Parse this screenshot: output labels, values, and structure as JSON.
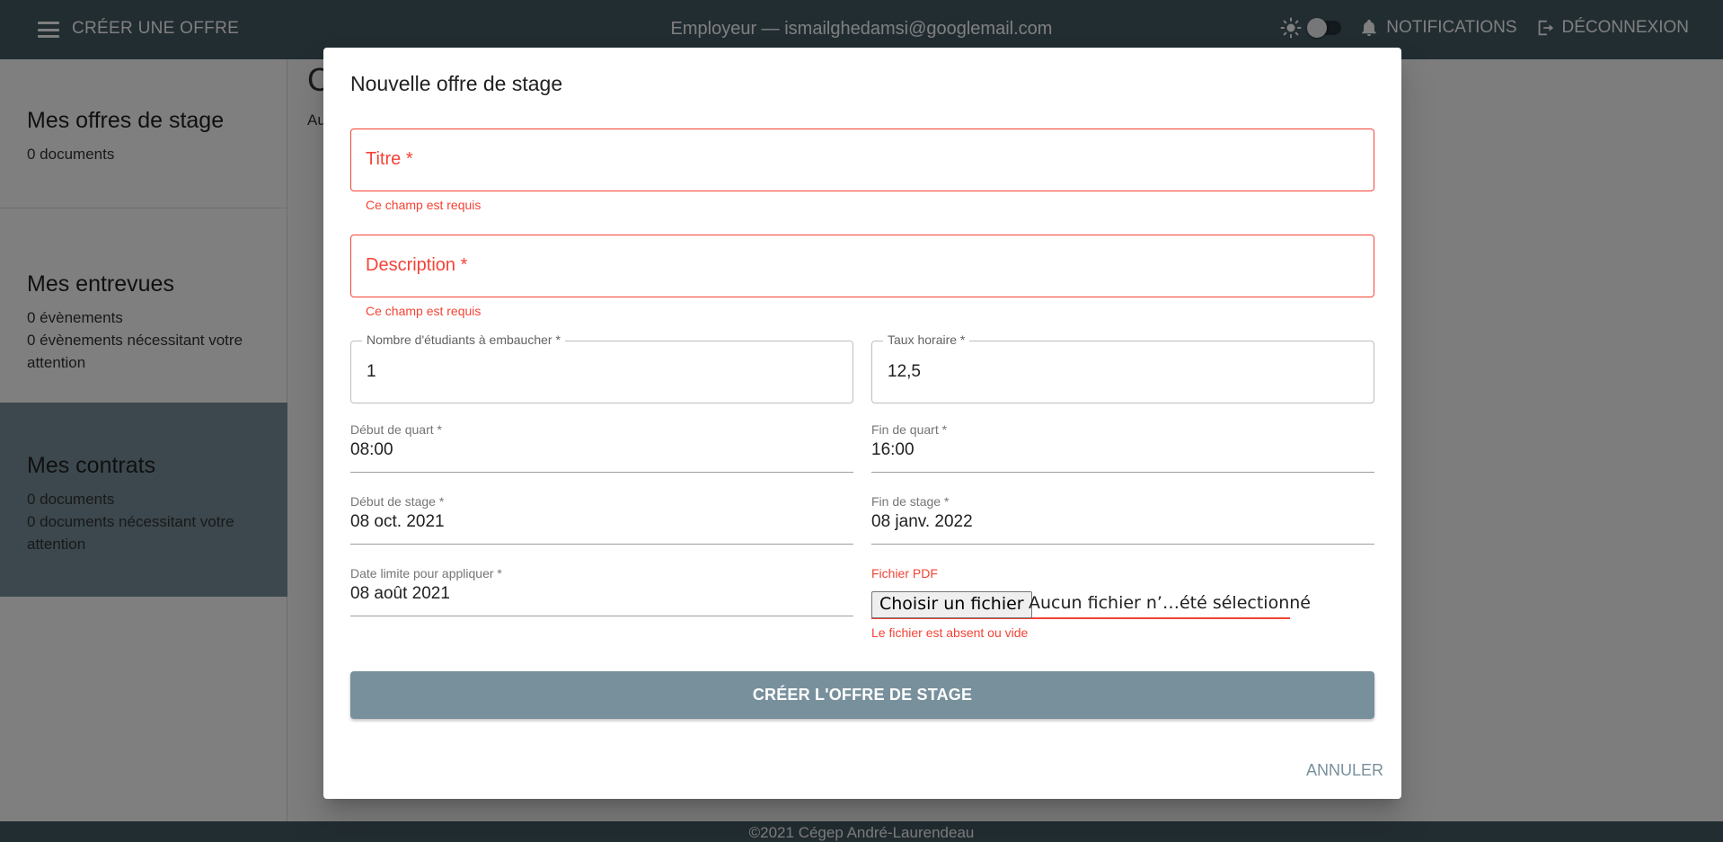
{
  "appbar": {
    "create_label": "CRÉER UNE OFFRE",
    "user_label": "Employeur — ismailghedamsi@googlemail.com",
    "notifications_label": "NOTIFICATIONS",
    "logout_label": "DÉCONNEXION"
  },
  "sidebar": {
    "cards": [
      {
        "title": "Mes offres de stage",
        "lines": [
          "0 documents"
        ]
      },
      {
        "title": "Mes entrevues",
        "lines": [
          "0 évènements",
          "0 évènements nécessitant votre attention"
        ]
      },
      {
        "title": "Mes contrats",
        "lines": [
          "0 documents",
          "0 documents nécessitant votre attention"
        ]
      }
    ]
  },
  "main": {
    "title_partial": "C",
    "sub_partial": "Au"
  },
  "footer": {
    "text": "©2021 Cégep André-Laurendeau"
  },
  "dialog": {
    "title": "Nouvelle offre de stage",
    "titre": {
      "placeholder": "Titre *",
      "error": "Ce champ est requis"
    },
    "description": {
      "placeholder": "Description *",
      "error": "Ce champ est requis"
    },
    "nb_etudiants": {
      "label": "Nombre d'étudiants à embaucher *",
      "value": "1"
    },
    "taux_horaire": {
      "label": "Taux horaire *",
      "value": "12,5"
    },
    "debut_quart": {
      "label": "Début de quart *",
      "value": "08:00"
    },
    "fin_quart": {
      "label": "Fin de quart *",
      "value": "16:00"
    },
    "debut_stage": {
      "label": "Début de stage *",
      "value": "08 oct. 2021"
    },
    "fin_stage": {
      "label": "Fin de stage *",
      "value": "08 janv. 2022"
    },
    "date_limite": {
      "label": "Date limite pour appliquer *",
      "value": "08 août 2021"
    },
    "fichier": {
      "label": "Fichier PDF",
      "button": "Choisir un fichier",
      "status": "Aucun fichier n’…été sélectionné",
      "error": "Le fichier est absent ou vide"
    },
    "submit_label": "CRÉER L'OFFRE DE STAGE",
    "cancel_label": "ANNULER"
  },
  "colors": {
    "appbar": "#455a64",
    "accent": "#78909c",
    "error": "#f44336"
  },
  "icons": {
    "menu": "menu-icon",
    "theme": "sun-icon",
    "notifications": "bell-icon",
    "logout": "logout-icon"
  }
}
